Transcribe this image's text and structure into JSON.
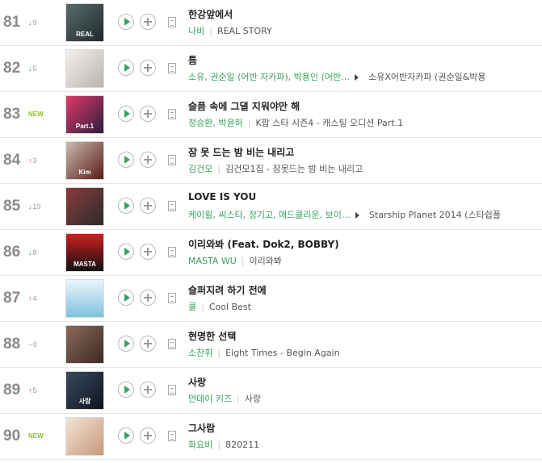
{
  "rows": [
    {
      "rank": "81",
      "change": {
        "dir": "down",
        "value": "9"
      },
      "title": "한강앞에서",
      "artist": "나비",
      "album": "REAL STORY",
      "more": false,
      "cover": {
        "bg": "linear-gradient(135deg,#5a6b6b,#1f2a2a)",
        "label": "REAL"
      }
    },
    {
      "rank": "82",
      "change": {
        "dir": "down",
        "value": "5"
      },
      "title": "틈",
      "artist": "소유, 권순일 (어반 자카파), 박용인 (어반…",
      "album": "소유X어반자카파 (권순일&박용",
      "more": true,
      "cover": {
        "bg": "linear-gradient(135deg,#f3f0ee,#b9b3b1)",
        "label": ""
      }
    },
    {
      "rank": "83",
      "change": {
        "dir": "new",
        "value": "NEW"
      },
      "title": "슬픔 속에 그댈 지워야만 해",
      "artist": "정승환, 박윤하",
      "album": "K팝 스타 시즌4 - 캐스팅 오디션 Part.1",
      "more": false,
      "cover": {
        "bg": "linear-gradient(135deg,#e23b6a,#2c1d3d)",
        "label": "Part.1"
      }
    },
    {
      "rank": "84",
      "change": {
        "dir": "up",
        "value": "3"
      },
      "title": "잠 못 드는 밤 비는 내리고",
      "artist": "김건모",
      "album": "김건모1집 - 잠못드는 밤 비는 내리고",
      "more": false,
      "cover": {
        "bg": "linear-gradient(135deg,#c8bcb0,#5c1a16)",
        "label": "Kim"
      }
    },
    {
      "rank": "85",
      "change": {
        "dir": "down",
        "value": "19"
      },
      "title": "LOVE IS YOU",
      "artist": "케이윌, 씨스타, 정기고, 매드클라운, 보이…",
      "album": "Starship Planet 2014 (스타쉽플",
      "more": true,
      "cover": {
        "bg": "linear-gradient(135deg,#8d3b3b,#2b2b2b)",
        "label": ""
      }
    },
    {
      "rank": "86",
      "change": {
        "dir": "down",
        "value": "8"
      },
      "title": "이리와봐 (Feat. Dok2, BOBBY)",
      "artist": "MASTA WU",
      "album": "이리와봐",
      "more": false,
      "cover": {
        "bg": "linear-gradient(180deg,#d01e1e,#111111)",
        "label": "MASTA"
      }
    },
    {
      "rank": "87",
      "change": {
        "dir": "up",
        "value": "4"
      },
      "title": "슬퍼지려 하기 전에",
      "artist": "쿨",
      "album": "Cool Best",
      "more": false,
      "cover": {
        "bg": "linear-gradient(180deg,#eaf5fb,#7ec2df)",
        "label": ""
      }
    },
    {
      "rank": "88",
      "change": {
        "dir": "same",
        "value": "0"
      },
      "title": "현명한 선택",
      "artist": "소찬휘",
      "album": "Eight Times - Begin Again",
      "more": false,
      "cover": {
        "bg": "linear-gradient(135deg,#8a6a5a,#3d2a22)",
        "label": ""
      }
    },
    {
      "rank": "89",
      "change": {
        "dir": "up",
        "value": "5"
      },
      "title": "사랑",
      "artist": "먼데이 키즈",
      "album": "사랑",
      "more": false,
      "cover": {
        "bg": "linear-gradient(135deg,#3b4a5f,#0e1420)",
        "label": "사랑"
      }
    },
    {
      "rank": "90",
      "change": {
        "dir": "new",
        "value": "NEW"
      },
      "title": "그사람",
      "artist": "화요비",
      "album": "820211",
      "more": false,
      "cover": {
        "bg": "linear-gradient(135deg,#f2e3d5,#c99a7a)",
        "label": ""
      }
    }
  ],
  "colors": {
    "artist": "#3aa05f",
    "down": "#3aa05f",
    "up": "#e84a5f",
    "new": "#8dc21f",
    "rank": "#8a8a8a"
  },
  "icons": {
    "play": "play-icon",
    "add": "plus-icon",
    "lyrics": "lyrics-icon",
    "more": "more-arrow-icon"
  }
}
